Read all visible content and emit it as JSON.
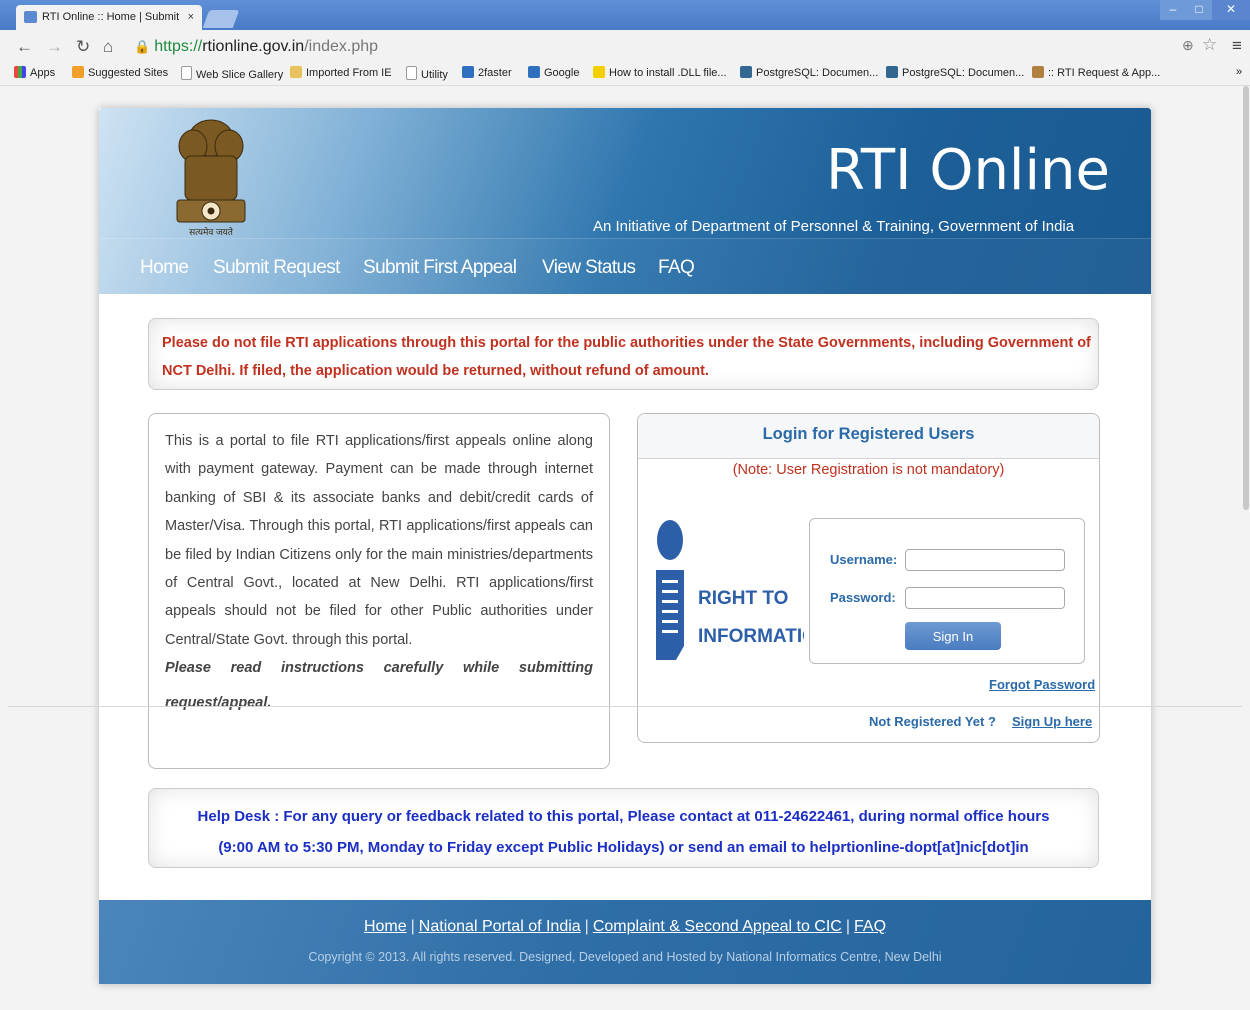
{
  "browser": {
    "tab_title": "RTI Online :: Home | Submit",
    "tab_close": "×",
    "url_https": "https://",
    "url_host": "rtionline.gov.in",
    "url_path": "/index.php",
    "bookmarks": [
      "Apps",
      "Suggested Sites",
      "Web Slice Gallery",
      "Imported From IE",
      "Utility",
      "2faster",
      "Google",
      "How to install .DLL file...",
      "PostgreSQL: Documen...",
      "PostgreSQL: Documen...",
      ":: RTI Request & App..."
    ],
    "bookmarks_overflow": "»"
  },
  "header": {
    "title": "RTI Online",
    "subtitle": "An Initiative of Department of Personnel & Training, Government of India",
    "emblem_motto": "सत्यमेव जयते",
    "nav": [
      "Home",
      "Submit Request",
      "Submit First Appeal",
      "View Status",
      "FAQ"
    ]
  },
  "warning": "Please do not file RTI applications through this portal for the public authorities under the State Governments, including Government of NCT Delhi. If filed, the application would be returned, without refund of amount.",
  "info": {
    "text": "This is a portal to file RTI applications/first appeals online along with payment gateway. Payment can be made through internet banking of SBI & its associate banks and debit/credit cards of Master/Visa. Through this portal, RTI applications/first appeals can be filed by Indian Citizens only for the main ministries/departments of Central Govt., located at New Delhi. RTI applications/first appeals should not be filed for other Public authorities under Central/State Govt. through this portal.",
    "instruction_1": "Please read instructions carefully while submitting",
    "instruction_2": "request/appeal."
  },
  "login": {
    "heading": "Login for Registered Users",
    "note": "(Note: User Registration is not mandatory)",
    "logo_line1": "RIGHT TO",
    "logo_line2": "INFORMATION",
    "username_label": "Username:",
    "password_label": "Password:",
    "username_value": "",
    "password_value": "",
    "signin_label": "Sign In",
    "forgot_label": "Forgot Password",
    "not_registered": "Not Registered Yet ?",
    "signup_label": "Sign Up here"
  },
  "helpdesk": {
    "line1": "Help Desk : For any query or feedback related to this portal, Please contact at 011-24622461, during normal office hours",
    "line2": "(9:00 AM to 5:30 PM, Monday to Friday except Public Holidays) or send an email to helprtionline-dopt[at]nic[dot]in"
  },
  "footer": {
    "links": [
      "Home",
      "National Portal of India",
      "Complaint & Second Appeal to CIC",
      "FAQ"
    ],
    "separator": "|",
    "copyright": "Copyright © 2013. All rights reserved. Designed, Developed and Hosted by National Informatics Centre, New Delhi"
  }
}
